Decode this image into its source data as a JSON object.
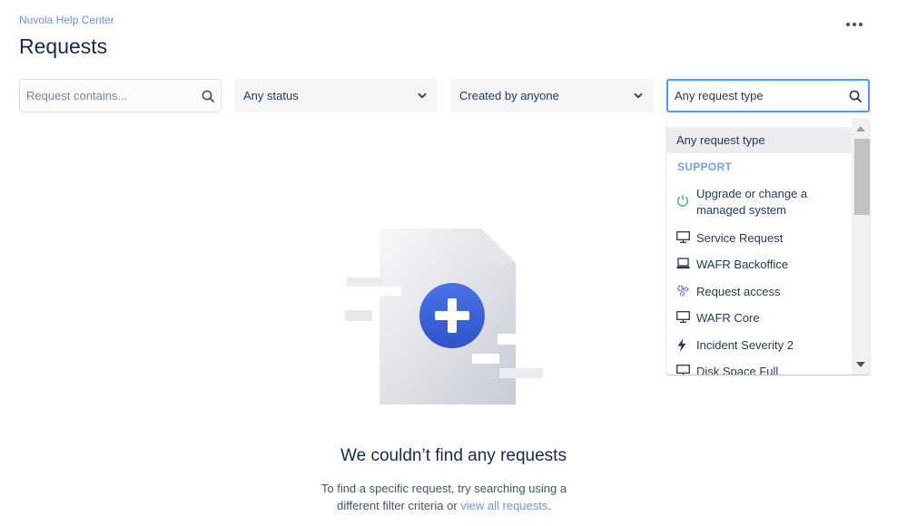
{
  "breadcrumb": "Nuvola Help Center",
  "page_title": "Requests",
  "filters": {
    "search_placeholder": "Request contains...",
    "status_value": "Any status",
    "creator_value": "Created by anyone",
    "request_type_placeholder": "Any request type"
  },
  "dropdown": {
    "top_option": "Any request type",
    "group_label": "SUPPORT",
    "options": [
      {
        "label": "Upgrade or change a managed system",
        "icon": "power-icon"
      },
      {
        "label": "Service Request",
        "icon": "monitor-icon"
      },
      {
        "label": "WAFR Backoffice",
        "icon": "laptop-icon"
      },
      {
        "label": "Request access",
        "icon": "gears-icon"
      },
      {
        "label": "WAFR Core",
        "icon": "monitor-icon"
      },
      {
        "label": "Incident Severity 2",
        "icon": "lightning-icon"
      },
      {
        "label": "Disk Space Full",
        "icon": "monitor-icon"
      }
    ]
  },
  "empty_state": {
    "title": "We couldn’t find any requests",
    "text_before": "To find a specific request, try searching using a different filter criteria or ",
    "link": "view all requests",
    "text_after": "."
  },
  "colors": {
    "accent": "#4c9aff",
    "link": "#6b95e3",
    "group_label": "#79a0e0",
    "plus_circle": "#3e63d8",
    "power_icon": "#36b37e"
  }
}
